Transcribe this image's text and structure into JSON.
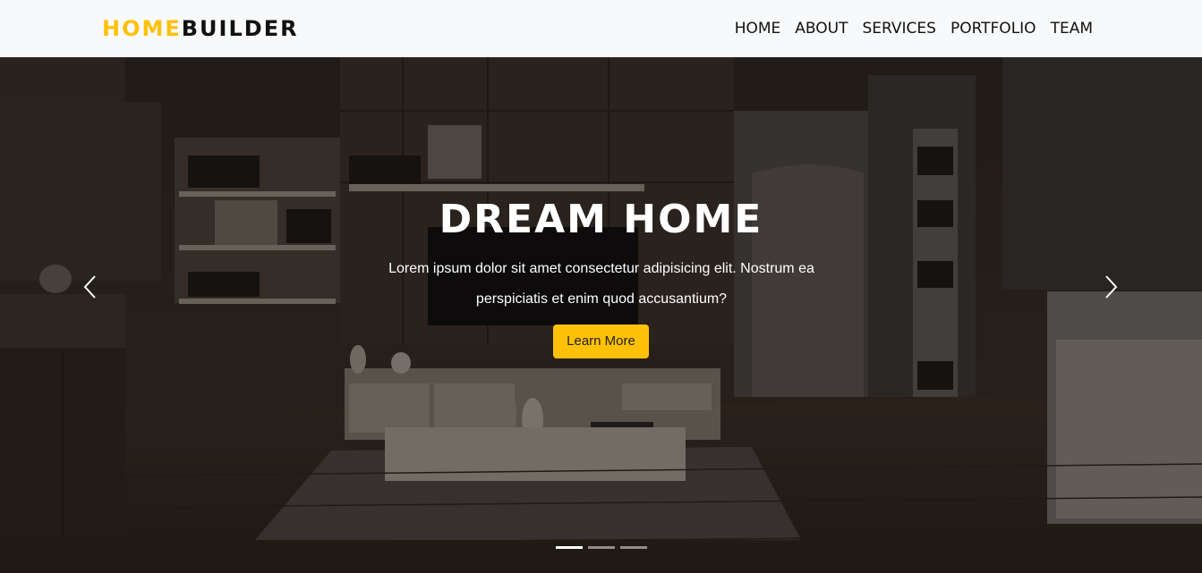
{
  "brand": {
    "part1": "HOME",
    "part2": "BUILDER"
  },
  "nav": {
    "items": [
      "HOME",
      "ABOUT",
      "SERVICES",
      "PORTFOLIO",
      "TEAM"
    ]
  },
  "hero": {
    "title": "DREAM HOME",
    "text": "Lorem ipsum dolor sit amet consectetur adipisicing elit. Nostrum ea perspiciatis et enim quod accusantium?",
    "button_label": "Learn More",
    "active_slide": 1,
    "slide_count": 3
  },
  "colors": {
    "accent": "#ffc107",
    "navbar_bg": "#f8f9fa",
    "brand_dark": "#111111"
  },
  "icons": {
    "prev": "chevron-left-icon",
    "next": "chevron-right-icon"
  }
}
